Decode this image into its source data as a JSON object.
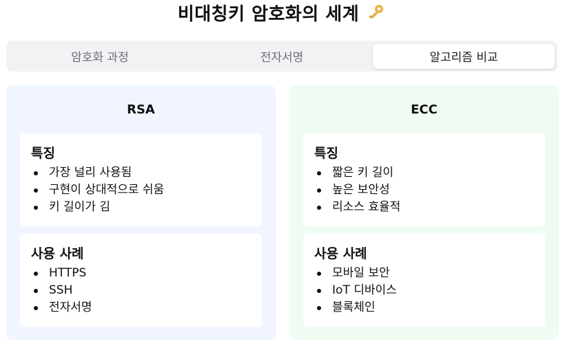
{
  "header": {
    "title": "비대칭키 암호화의 세계",
    "icon": "key-icon",
    "icon_color": "#e8b54a"
  },
  "tabs": [
    {
      "label": "암호화 과정",
      "active": false
    },
    {
      "label": "전자서명",
      "active": false
    },
    {
      "label": "알고리즘 비교",
      "active": true
    }
  ],
  "panels": {
    "rsa": {
      "title": "RSA",
      "background": "#f0f5ff",
      "features": {
        "heading": "특징",
        "items": [
          "가장 널리 사용됨",
          "구현이 상대적으로 쉬움",
          "키 길이가 김"
        ]
      },
      "use_cases": {
        "heading": "사용 사례",
        "items": [
          "HTTPS",
          "SSH",
          "전자서명"
        ]
      }
    },
    "ecc": {
      "title": "ECC",
      "background": "#f0fcf2",
      "features": {
        "heading": "특징",
        "items": [
          "짧은 키 길이",
          "높은 보안성",
          "리소스 효율적"
        ]
      },
      "use_cases": {
        "heading": "사용 사례",
        "items": [
          "모바일 보안",
          "IoT 디바이스",
          "블록체인"
        ]
      }
    }
  }
}
